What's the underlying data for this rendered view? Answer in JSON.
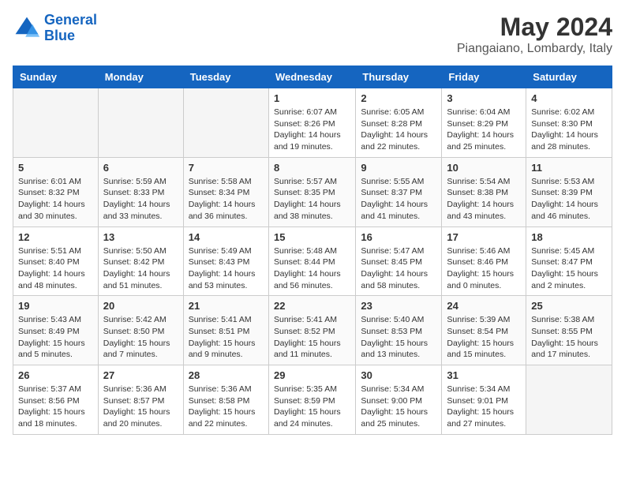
{
  "header": {
    "logo_line1": "General",
    "logo_line2": "Blue",
    "month": "May 2024",
    "location": "Piangaiano, Lombardy, Italy"
  },
  "weekdays": [
    "Sunday",
    "Monday",
    "Tuesday",
    "Wednesday",
    "Thursday",
    "Friday",
    "Saturday"
  ],
  "weeks": [
    [
      {
        "day": "",
        "info": ""
      },
      {
        "day": "",
        "info": ""
      },
      {
        "day": "",
        "info": ""
      },
      {
        "day": "1",
        "info": "Sunrise: 6:07 AM\nSunset: 8:26 PM\nDaylight: 14 hours\nand 19 minutes."
      },
      {
        "day": "2",
        "info": "Sunrise: 6:05 AM\nSunset: 8:28 PM\nDaylight: 14 hours\nand 22 minutes."
      },
      {
        "day": "3",
        "info": "Sunrise: 6:04 AM\nSunset: 8:29 PM\nDaylight: 14 hours\nand 25 minutes."
      },
      {
        "day": "4",
        "info": "Sunrise: 6:02 AM\nSunset: 8:30 PM\nDaylight: 14 hours\nand 28 minutes."
      }
    ],
    [
      {
        "day": "5",
        "info": "Sunrise: 6:01 AM\nSunset: 8:32 PM\nDaylight: 14 hours\nand 30 minutes."
      },
      {
        "day": "6",
        "info": "Sunrise: 5:59 AM\nSunset: 8:33 PM\nDaylight: 14 hours\nand 33 minutes."
      },
      {
        "day": "7",
        "info": "Sunrise: 5:58 AM\nSunset: 8:34 PM\nDaylight: 14 hours\nand 36 minutes."
      },
      {
        "day": "8",
        "info": "Sunrise: 5:57 AM\nSunset: 8:35 PM\nDaylight: 14 hours\nand 38 minutes."
      },
      {
        "day": "9",
        "info": "Sunrise: 5:55 AM\nSunset: 8:37 PM\nDaylight: 14 hours\nand 41 minutes."
      },
      {
        "day": "10",
        "info": "Sunrise: 5:54 AM\nSunset: 8:38 PM\nDaylight: 14 hours\nand 43 minutes."
      },
      {
        "day": "11",
        "info": "Sunrise: 5:53 AM\nSunset: 8:39 PM\nDaylight: 14 hours\nand 46 minutes."
      }
    ],
    [
      {
        "day": "12",
        "info": "Sunrise: 5:51 AM\nSunset: 8:40 PM\nDaylight: 14 hours\nand 48 minutes."
      },
      {
        "day": "13",
        "info": "Sunrise: 5:50 AM\nSunset: 8:42 PM\nDaylight: 14 hours\nand 51 minutes."
      },
      {
        "day": "14",
        "info": "Sunrise: 5:49 AM\nSunset: 8:43 PM\nDaylight: 14 hours\nand 53 minutes."
      },
      {
        "day": "15",
        "info": "Sunrise: 5:48 AM\nSunset: 8:44 PM\nDaylight: 14 hours\nand 56 minutes."
      },
      {
        "day": "16",
        "info": "Sunrise: 5:47 AM\nSunset: 8:45 PM\nDaylight: 14 hours\nand 58 minutes."
      },
      {
        "day": "17",
        "info": "Sunrise: 5:46 AM\nSunset: 8:46 PM\nDaylight: 15 hours\nand 0 minutes."
      },
      {
        "day": "18",
        "info": "Sunrise: 5:45 AM\nSunset: 8:47 PM\nDaylight: 15 hours\nand 2 minutes."
      }
    ],
    [
      {
        "day": "19",
        "info": "Sunrise: 5:43 AM\nSunset: 8:49 PM\nDaylight: 15 hours\nand 5 minutes."
      },
      {
        "day": "20",
        "info": "Sunrise: 5:42 AM\nSunset: 8:50 PM\nDaylight: 15 hours\nand 7 minutes."
      },
      {
        "day": "21",
        "info": "Sunrise: 5:41 AM\nSunset: 8:51 PM\nDaylight: 15 hours\nand 9 minutes."
      },
      {
        "day": "22",
        "info": "Sunrise: 5:41 AM\nSunset: 8:52 PM\nDaylight: 15 hours\nand 11 minutes."
      },
      {
        "day": "23",
        "info": "Sunrise: 5:40 AM\nSunset: 8:53 PM\nDaylight: 15 hours\nand 13 minutes."
      },
      {
        "day": "24",
        "info": "Sunrise: 5:39 AM\nSunset: 8:54 PM\nDaylight: 15 hours\nand 15 minutes."
      },
      {
        "day": "25",
        "info": "Sunrise: 5:38 AM\nSunset: 8:55 PM\nDaylight: 15 hours\nand 17 minutes."
      }
    ],
    [
      {
        "day": "26",
        "info": "Sunrise: 5:37 AM\nSunset: 8:56 PM\nDaylight: 15 hours\nand 18 minutes."
      },
      {
        "day": "27",
        "info": "Sunrise: 5:36 AM\nSunset: 8:57 PM\nDaylight: 15 hours\nand 20 minutes."
      },
      {
        "day": "28",
        "info": "Sunrise: 5:36 AM\nSunset: 8:58 PM\nDaylight: 15 hours\nand 22 minutes."
      },
      {
        "day": "29",
        "info": "Sunrise: 5:35 AM\nSunset: 8:59 PM\nDaylight: 15 hours\nand 24 minutes."
      },
      {
        "day": "30",
        "info": "Sunrise: 5:34 AM\nSunset: 9:00 PM\nDaylight: 15 hours\nand 25 minutes."
      },
      {
        "day": "31",
        "info": "Sunrise: 5:34 AM\nSunset: 9:01 PM\nDaylight: 15 hours\nand 27 minutes."
      },
      {
        "day": "",
        "info": ""
      }
    ]
  ]
}
